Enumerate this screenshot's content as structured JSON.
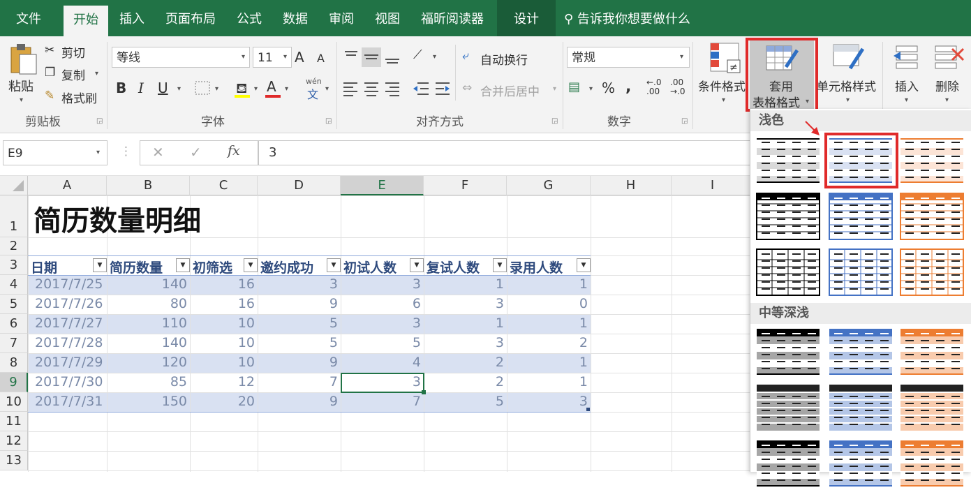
{
  "tabs": [
    "文件",
    "开始",
    "插入",
    "页面布局",
    "公式",
    "数据",
    "审阅",
    "视图",
    "福昕阅读器",
    "设计"
  ],
  "tell_me": "告诉我你想要做什么",
  "clipboard": {
    "paste": "粘贴",
    "cut": "剪切",
    "copy": "复制",
    "format_painter": "格式刷",
    "group": "剪贴板"
  },
  "font": {
    "name": "等线",
    "size": "11",
    "group": "字体",
    "grow": "A",
    "shrink": "A",
    "bold": "B",
    "italic": "I",
    "underline": "U",
    "font_color": "A",
    "phonetic_top": "wén",
    "phonetic_bottom": "文"
  },
  "alignment": {
    "wrap": "自动换行",
    "merge": "合并后居中",
    "group": "对齐方式"
  },
  "number": {
    "format": "常规",
    "percent": "%",
    "comma": ",",
    "inc_decimal": "←.0\n.00",
    "dec_decimal": ".00\n→.0",
    "group": "数字"
  },
  "styles": {
    "conditional": "条件格式",
    "table_format_l1": "套用",
    "table_format_l2": "表格格式",
    "cell_styles": "单元格样式"
  },
  "cells": {
    "insert": "插入",
    "delete": "删除"
  },
  "formula_bar": {
    "name_box": "E9",
    "fx": "fx",
    "value": "3"
  },
  "columns": [
    "A",
    "B",
    "C",
    "D",
    "E",
    "F",
    "G",
    "H",
    "I"
  ],
  "rows": [
    "1",
    "2",
    "3",
    "4",
    "5",
    "6",
    "7",
    "8",
    "9",
    "10",
    "11",
    "12",
    "13"
  ],
  "sheet": {
    "title": "简历数量明细",
    "headers": [
      "日期",
      "简历数量",
      "初筛选",
      "邀约成功",
      "初试人数",
      "复试人数",
      "录用人数"
    ],
    "data": [
      [
        "2017/7/25",
        "140",
        "16",
        "3",
        "3",
        "1",
        "1"
      ],
      [
        "2017/7/26",
        "80",
        "16",
        "9",
        "6",
        "3",
        "0"
      ],
      [
        "2017/7/27",
        "110",
        "10",
        "5",
        "3",
        "1",
        "1"
      ],
      [
        "2017/7/28",
        "140",
        "10",
        "5",
        "5",
        "3",
        "2"
      ],
      [
        "2017/7/29",
        "120",
        "10",
        "9",
        "4",
        "2",
        "1"
      ],
      [
        "2017/7/30",
        "85",
        "12",
        "7",
        "3",
        "2",
        "1"
      ],
      [
        "2017/7/31",
        "150",
        "20",
        "9",
        "7",
        "5",
        "3"
      ]
    ]
  },
  "gallery": {
    "light_label": "浅色",
    "medium_label": "中等深浅"
  },
  "colors": {
    "excel_green": "#217346",
    "highlight_red": "#e02a2a",
    "band_blue": "#d9e1f2"
  }
}
